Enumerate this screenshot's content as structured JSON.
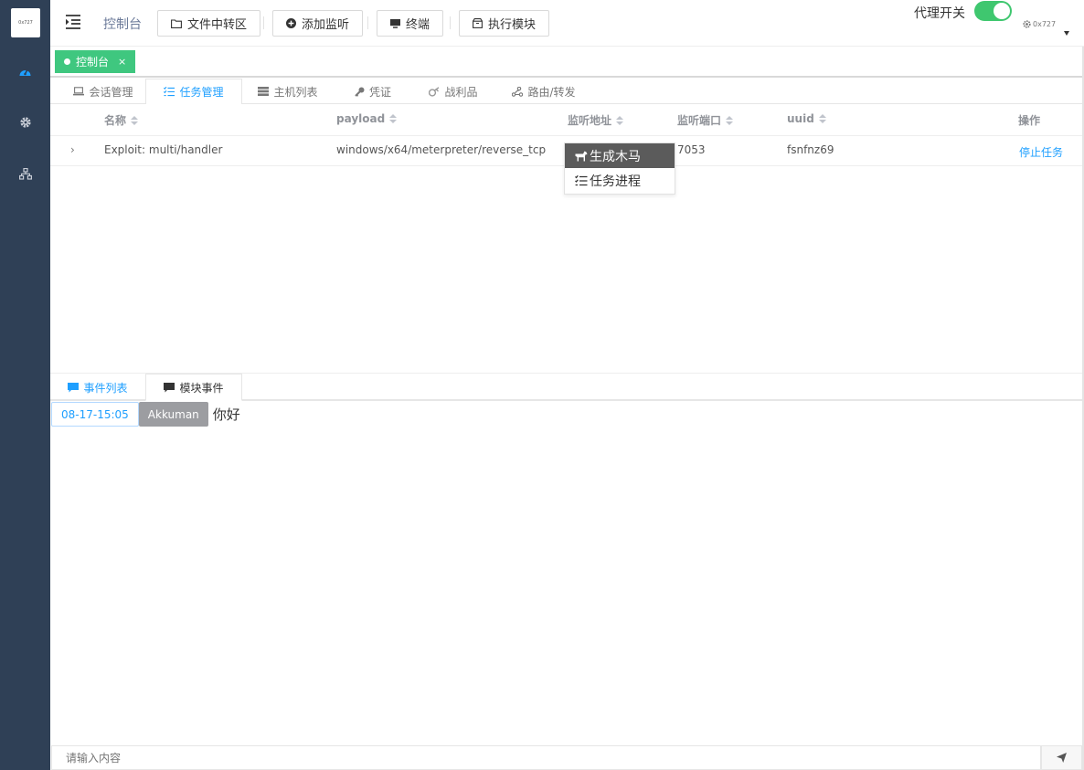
{
  "app": {
    "logo_text": "0x727",
    "user_name": "0x727"
  },
  "header": {
    "title": "控制台",
    "buttons": [
      "文件中转区",
      "添加监听",
      "终端",
      "执行模块"
    ],
    "proxy_label": "代理开关",
    "proxy_enabled": true
  },
  "pagetab": {
    "label": "控制台",
    "close": "×"
  },
  "tabs": [
    "会话管理",
    "任务管理",
    "主机列表",
    "凭证",
    "战利品",
    "路由/转发"
  ],
  "active_tab": "任务管理",
  "table": {
    "headers": [
      "名称",
      "payload",
      "监听地址",
      "监听端口",
      "uuid",
      "操作"
    ],
    "rows": [
      {
        "name": "Exploit: multi/handler",
        "payload": "windows/x64/meterpreter/reverse_tcp",
        "port": "7053",
        "uuid": "fsnfnz69",
        "action": "停止任务"
      }
    ]
  },
  "context_menu": [
    "生成木马",
    "任务进程"
  ],
  "bottom_tabs": [
    "事件列表",
    "模块事件"
  ],
  "events": [
    {
      "time": "08-17-15:05",
      "user": "Akkuman",
      "message": "你好"
    }
  ],
  "input": {
    "placeholder": "请输入内容"
  },
  "colors": {
    "sidebar": "#2f4056",
    "accent": "#1e9fff",
    "green": "#3fc77f"
  }
}
